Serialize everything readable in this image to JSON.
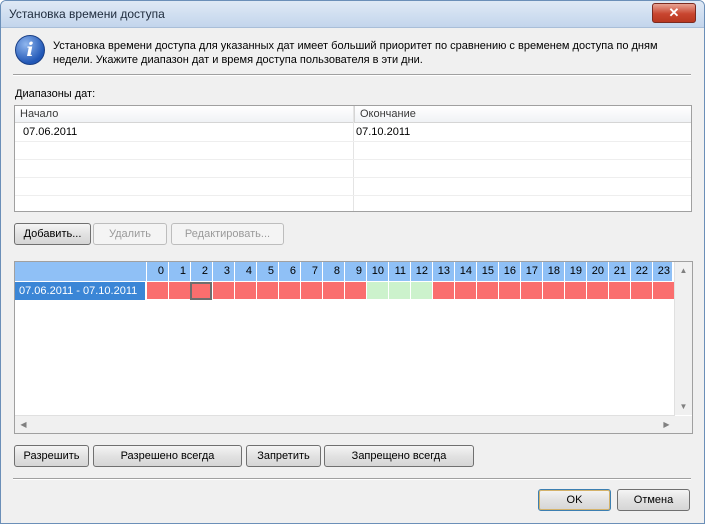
{
  "window": {
    "title": "Установка времени доступа",
    "close_glyph": "✕"
  },
  "info": {
    "icon": "info-icon",
    "icon_glyph": "i",
    "line1": "Установка времени доступа для указанных дат имеет больший приоритет по сравнению с временем доступа по дням",
    "line2": "недели. Укажите диапазон дат и время доступа пользователя в эти дни."
  },
  "ranges": {
    "label": "Диапазоны дат:",
    "columns": [
      "Начало",
      "Окончание"
    ],
    "rows": [
      {
        "start": "07.06.2011",
        "end": "07.10.2011"
      }
    ]
  },
  "range_buttons": {
    "add": "Добавить...",
    "remove": "Удалить",
    "edit": "Редактировать..."
  },
  "schedule": {
    "hours": [
      "0",
      "1",
      "2",
      "3",
      "4",
      "5",
      "6",
      "7",
      "8",
      "9",
      "10",
      "11",
      "12",
      "13",
      "14",
      "15",
      "16",
      "17",
      "18",
      "19",
      "20",
      "21",
      "22",
      "23"
    ],
    "row_label": "07.06.2011 - 07.10.2011",
    "slots": [
      "deny",
      "deny",
      "deny",
      "deny",
      "deny",
      "deny",
      "deny",
      "deny",
      "deny",
      "deny",
      "allow",
      "allow",
      "allow",
      "deny",
      "deny",
      "deny",
      "deny",
      "deny",
      "deny",
      "deny",
      "deny",
      "deny",
      "deny",
      "deny"
    ],
    "selected_hour": 2,
    "colors": {
      "deny": "#fa6e6e",
      "allow": "#ccf2cc",
      "header": "#8fc0f6",
      "row_label": "#3b86d6"
    },
    "scroll": {
      "up": "▲",
      "down": "▼",
      "left": "◀",
      "right": "▶"
    }
  },
  "access_buttons": {
    "allow": "Разрешить",
    "allow_always": "Разрешено всегда",
    "deny": "Запретить",
    "deny_always": "Запрещено всегда"
  },
  "dialog_buttons": {
    "ok": "OK",
    "cancel": "Отмена"
  }
}
